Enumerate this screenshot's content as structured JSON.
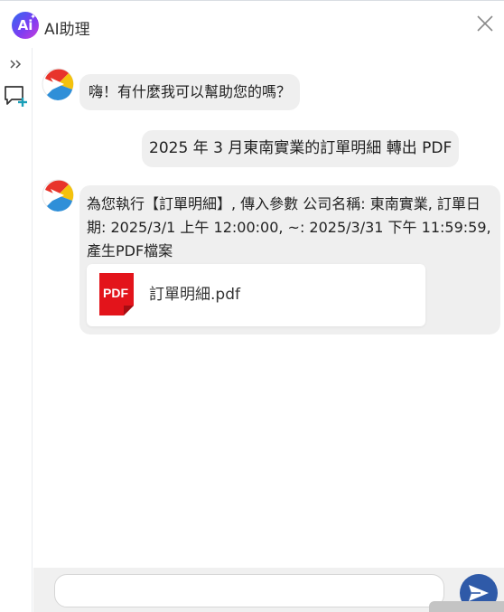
{
  "header": {
    "logo_text": "Ai",
    "title": "AI助理"
  },
  "messages": [
    {
      "role": "assistant",
      "text": "嗨！有什麼我可以幫助您的嗎？"
    },
    {
      "role": "user",
      "text": "2025 年 3 月東南實業的訂單明細 轉出 PDF"
    },
    {
      "role": "assistant",
      "text": "為您執行【訂單明細】, 傳入參數 公司名稱: 東南實業, 訂單日期: 2025/3/1 上午 12:00:00, ~: 2025/3/31 下午 11:59:59, 產生PDF檔案",
      "attachment": {
        "icon_label": "PDF",
        "file_name": "訂單明細.pdf"
      }
    }
  ],
  "input": {
    "value": "",
    "placeholder": ""
  },
  "icons": {
    "close": "close-icon",
    "expand": "double-chevron-right-icon",
    "new_chat": "new-chat-icon",
    "send": "send-icon",
    "pdf": "pdf-file-icon"
  },
  "colors": {
    "bubble": "#efefef",
    "send_button": "#2f5aa8",
    "pdf_red": "#e3141b",
    "new_chat_plus": "#1a9fb8"
  }
}
